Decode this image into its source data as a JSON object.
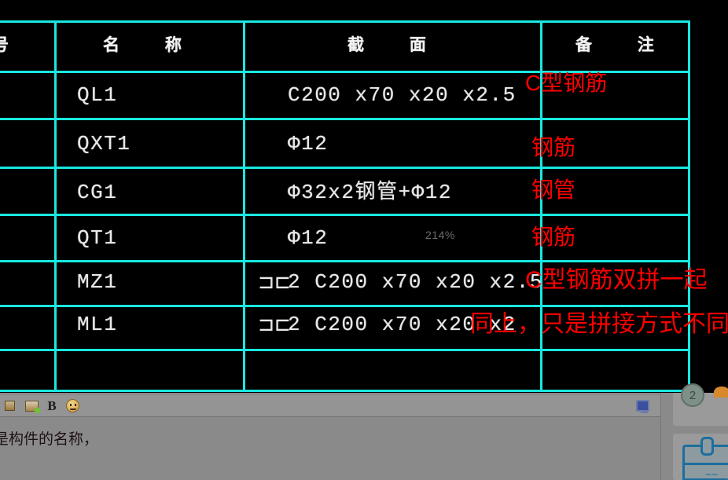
{
  "drawing": {
    "zoom_level": "214%",
    "grid_color": "#19e8e0",
    "text_color": "#e8e8e8",
    "annotation_color": "#ff0000",
    "background": "#000000",
    "headers": {
      "number": "号",
      "name": "名    称",
      "section": "截    面",
      "remark": "备    注"
    },
    "rows": [
      {
        "number": "",
        "name": "QL1",
        "section": "C200 x70 x20 x2.5",
        "section_prefix": "",
        "annotation": "C型钢筋"
      },
      {
        "number": "",
        "name": "QXT1",
        "section": "Φ12",
        "section_prefix": "",
        "annotation": "钢筋"
      },
      {
        "number": "",
        "name": "CG1",
        "section": "Φ32x2钢管+Φ12",
        "section_prefix": "",
        "annotation": "钢管"
      },
      {
        "number": "",
        "name": "QT1",
        "section": "Φ12",
        "section_prefix": "",
        "annotation": "钢筋"
      },
      {
        "number": "",
        "name": "MZ1",
        "section": "2 C200 x70 x20 x2.5",
        "section_prefix": "⊐⊏",
        "annotation": "C型钢筋双拼一起"
      },
      {
        "number": "",
        "name": "ML1",
        "section": "2 C200 x70 x20 x2",
        "section_prefix": "⊐⊏",
        "annotation": "同上，只是拼接方式不同"
      },
      {
        "number": "",
        "name": "",
        "section": "",
        "section_prefix": "",
        "annotation": ""
      }
    ]
  },
  "app": {
    "toolbar": {
      "insert_image_label": "image-attach",
      "image_label": "image",
      "bold_label": "B",
      "emoji_label": "emoji",
      "monitor_label": "screen"
    },
    "message": {
      "text": "是构件的名称，"
    },
    "right_panel": {
      "avatar_initial": "2"
    }
  }
}
